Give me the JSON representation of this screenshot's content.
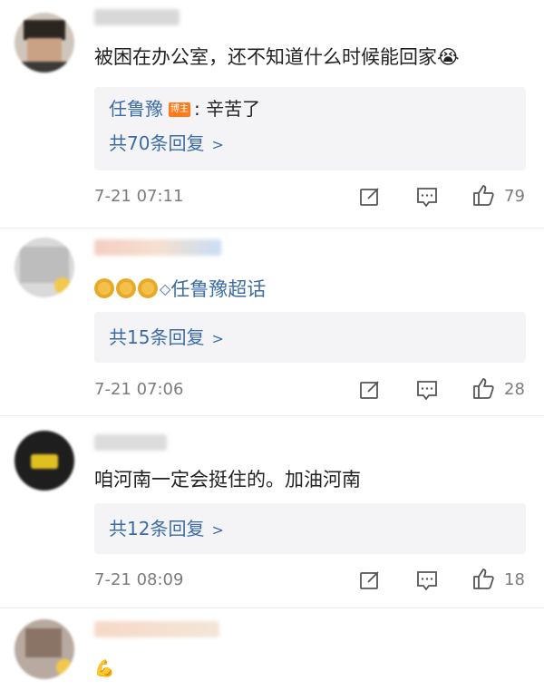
{
  "comments": [
    {
      "content": "被困在办公室，还不知道什么时候能回家😭",
      "reply_preview": {
        "user": "任鲁豫",
        "badge": "博主",
        "text": ": 辛苦了"
      },
      "reply_count": "共70条回复",
      "time": "7-21 07:11",
      "likes": "79"
    },
    {
      "content_link": "任鲁豫超话",
      "reply_count": "共15条回复",
      "time": "7-21 07:06",
      "likes": "28"
    },
    {
      "content": "咱河南一定会挺住的。加油河南",
      "reply_count": "共12条回复",
      "time": "7-21 08:09",
      "likes": "18"
    },
    {
      "content": "💪"
    }
  ],
  "icons": {
    "repost": "repost-icon",
    "comment": "comment-icon",
    "like": "like-icon",
    "chevron": "chevron-right-icon"
  },
  "colors": {
    "link": "#3c6ca7",
    "badge": "#ff7a1a",
    "reply_bg": "#f4f4f6"
  }
}
